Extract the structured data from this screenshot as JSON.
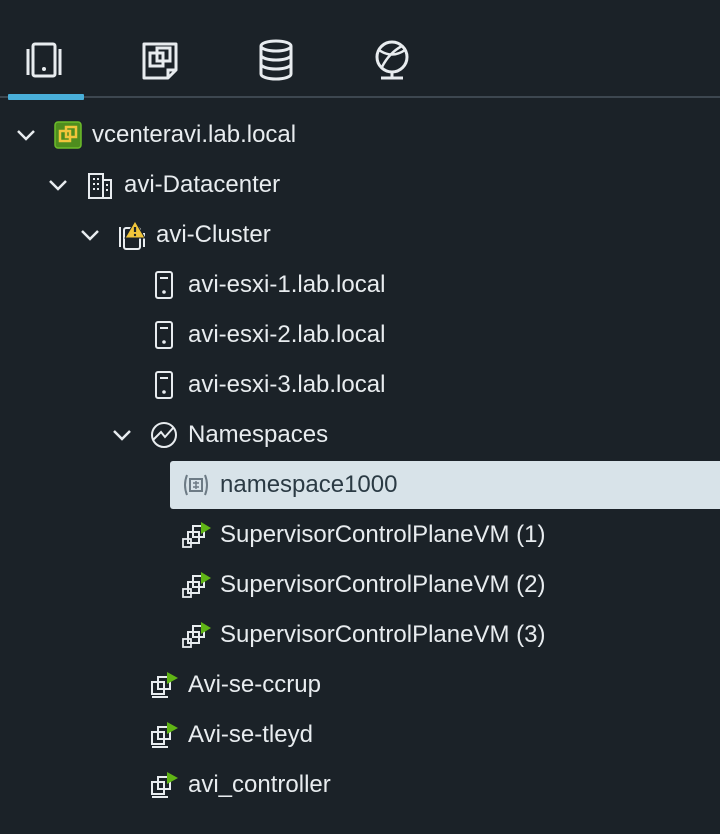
{
  "tabs": [
    {
      "name": "hosts-and-clusters-tab",
      "icon": "hosts-clusters-icon",
      "active": true
    },
    {
      "name": "vms-and-templates-tab",
      "icon": "vms-templates-icon",
      "active": false
    },
    {
      "name": "storage-tab",
      "icon": "datastore-icon",
      "active": false
    },
    {
      "name": "networking-tab",
      "icon": "network-icon",
      "active": false
    }
  ],
  "tree": {
    "vcenter": {
      "label": "vcenteravi.lab.local",
      "icon": "vcenter-icon"
    },
    "datacenter": {
      "label": "avi-Datacenter",
      "icon": "datacenter-icon"
    },
    "cluster": {
      "label": "avi-Cluster",
      "icon": "cluster-warning-icon"
    },
    "hosts": [
      {
        "label": "avi-esxi-1.lab.local",
        "icon": "host-icon"
      },
      {
        "label": "avi-esxi-2.lab.local",
        "icon": "host-icon"
      },
      {
        "label": "avi-esxi-3.lab.local",
        "icon": "host-icon"
      }
    ],
    "namespaces": {
      "label": "Namespaces",
      "icon": "namespaces-icon"
    },
    "namespace": {
      "label": "namespace1000",
      "icon": "namespace-icon",
      "selected": true
    },
    "control_plane_vms": [
      {
        "label": "SupervisorControlPlaneVM (1)",
        "icon": "vm-group-powered-on-icon"
      },
      {
        "label": "SupervisorControlPlaneVM (2)",
        "icon": "vm-group-powered-on-icon"
      },
      {
        "label": "SupervisorControlPlaneVM (3)",
        "icon": "vm-group-powered-on-icon"
      }
    ],
    "vms": [
      {
        "label": "Avi-se-ccrup",
        "icon": "vm-powered-on-icon"
      },
      {
        "label": "Avi-se-tleyd",
        "icon": "vm-powered-on-icon"
      },
      {
        "label": "avi_controller",
        "icon": "vm-powered-on-icon"
      }
    ]
  },
  "colors": {
    "background": "#1b2228",
    "accent": "#49afd9",
    "selected_row": "#d8e3e9",
    "power_on": "#60b515",
    "warning": "#f0c53b"
  }
}
